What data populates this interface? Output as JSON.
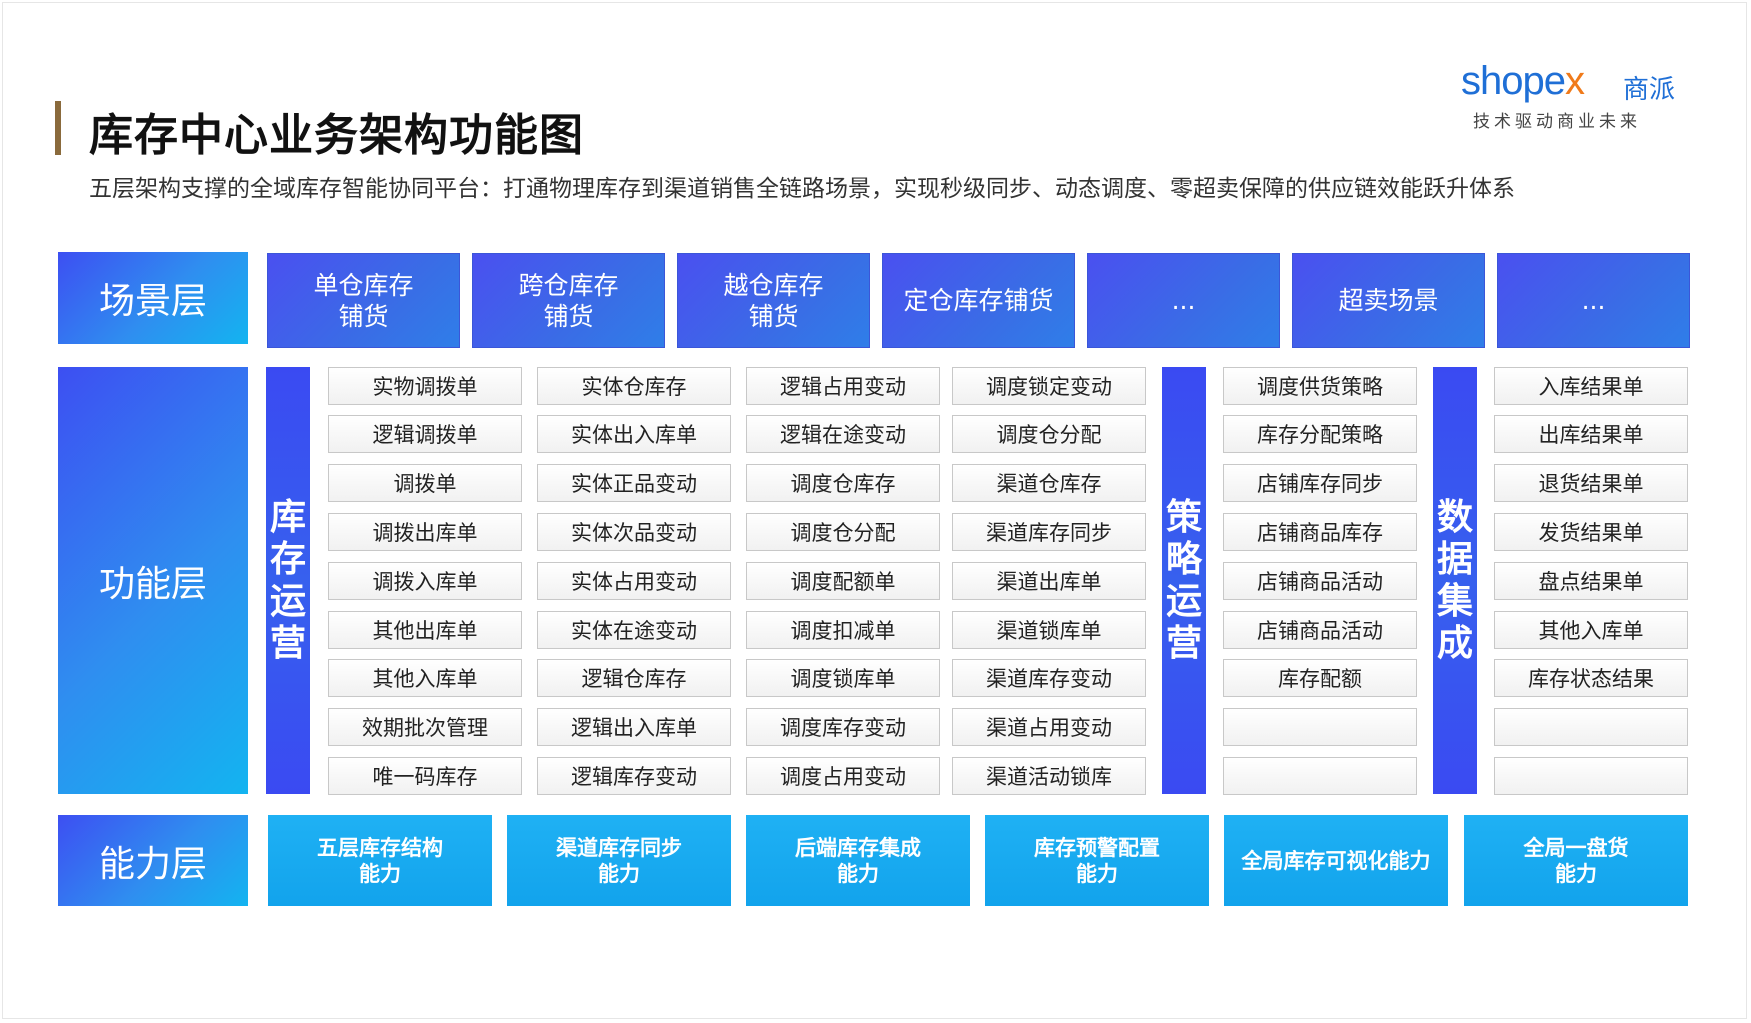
{
  "header": {
    "title": "库存中心业务架构功能图",
    "subtitle": "五层架构支撑的全域库存智能协同平台：打通物理库存到渠道销售全链路场景，实现秒级同步、动态调度、零超卖保障的供应链效能跃升体系"
  },
  "logo": {
    "brand_a": "shop",
    "brand_e": "e",
    "brand_x": "x",
    "brand_cn": "商派",
    "tagline": "技术驱动商业未来",
    "colors": {
      "primary": "#1f6fd6",
      "accent": "#f07a1a"
    }
  },
  "layers": {
    "scene": "场景层",
    "function": "功能层",
    "capability": "能力层"
  },
  "scenes": [
    "单仓库存\n铺货",
    "跨仓库存\n铺货",
    "越仓库存\n铺货",
    "定仓库存铺货",
    "...",
    "超卖场景",
    "..."
  ],
  "groups": {
    "inventory_ops": "库存运营",
    "strategy_ops": "策略运营",
    "data_integration": "数据集成"
  },
  "function_columns": {
    "col1": [
      "实物调拨单",
      "逻辑调拨单",
      "调拨单",
      "调拨出库单",
      "调拨入库单",
      "其他出库单",
      "其他入库单",
      "效期批次管理",
      "唯一码库存"
    ],
    "col2": [
      "实体仓库存",
      "实体出入库单",
      "实体正品变动",
      "实体次品变动",
      "实体占用变动",
      "实体在途变动",
      "逻辑仓库存",
      "逻辑出入库单",
      "逻辑库存变动"
    ],
    "col3": [
      "逻辑占用变动",
      "逻辑在途变动",
      "调度仓库存",
      "调度仓分配",
      "调度配额单",
      "调度扣减单",
      "调度锁库单",
      "调度库存变动",
      "调度占用变动"
    ],
    "col4": [
      "调度锁定变动",
      "调度仓分配",
      "渠道仓库存",
      "渠道库存同步",
      "渠道出库单",
      "渠道锁库单",
      "渠道库存变动",
      "渠道占用变动",
      "渠道活动锁库"
    ],
    "col5": [
      "调度供货策略",
      "库存分配策略",
      "店铺库存同步",
      "店铺商品库存",
      "店铺商品活动",
      "店铺商品活动",
      "库存配额",
      "",
      ""
    ],
    "col6": [
      "入库结果单",
      "出库结果单",
      "退货结果单",
      "发货结果单",
      "盘点结果单",
      "其他入库单",
      "库存状态结果",
      "",
      ""
    ]
  },
  "capabilities": [
    "五层库存结构\n能力",
    "渠道库存同步\n能力",
    "后端库存集成\n能力",
    "库存预警配置\n能力",
    "全局库存可视化能力",
    "全局一盘货\n能力"
  ],
  "colors": {
    "scene_box": "#3a5ce8",
    "layer_label": "#2f8ef0",
    "group_label": "#3a4af2",
    "capability_box": "#15a8ef",
    "title_bar": "#8a6a3c"
  }
}
